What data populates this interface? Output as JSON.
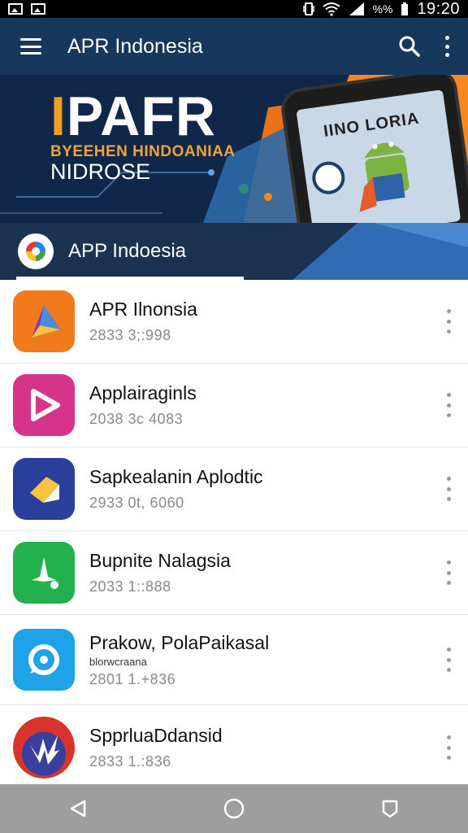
{
  "status_bar": {
    "time": "19:20",
    "battery": "%%"
  },
  "toolbar": {
    "title": "APR Indonesia"
  },
  "banner": {
    "brand_accent": "I",
    "brand": "PAFR",
    "subtitle": "BYEEHEN HINDOANIAA",
    "subtitle2": "NIDROSE",
    "phone_text": "IINO LORIA"
  },
  "section": {
    "title": "APP Indoesia"
  },
  "apps": [
    {
      "name": "APR Ilnonsia",
      "meta": "2833 3;:998",
      "icon": "triangle-play-icon"
    },
    {
      "name": "Applairaginls",
      "meta": "2038 3c 4083",
      "icon": "play-triangle-icon"
    },
    {
      "name": "Sapkealanin Aplodtic",
      "meta": "2933 0t, 6060",
      "icon": "folded-card-icon"
    },
    {
      "name": "Bupnite Nalagsia",
      "meta": "2033 1::888",
      "icon": "figure-icon"
    },
    {
      "name": "Prakow, PolaPaikasal",
      "sub": "blorwcraana",
      "meta": "2801 1.+836",
      "icon": "camera-ring-icon"
    },
    {
      "name": "SpprluaDdansid",
      "meta": "2833 1.:836",
      "icon": "lightning-icon"
    }
  ],
  "colors": {
    "toolbar": "#17385a",
    "banner": "#0f2748",
    "accent": "#f5891f"
  }
}
